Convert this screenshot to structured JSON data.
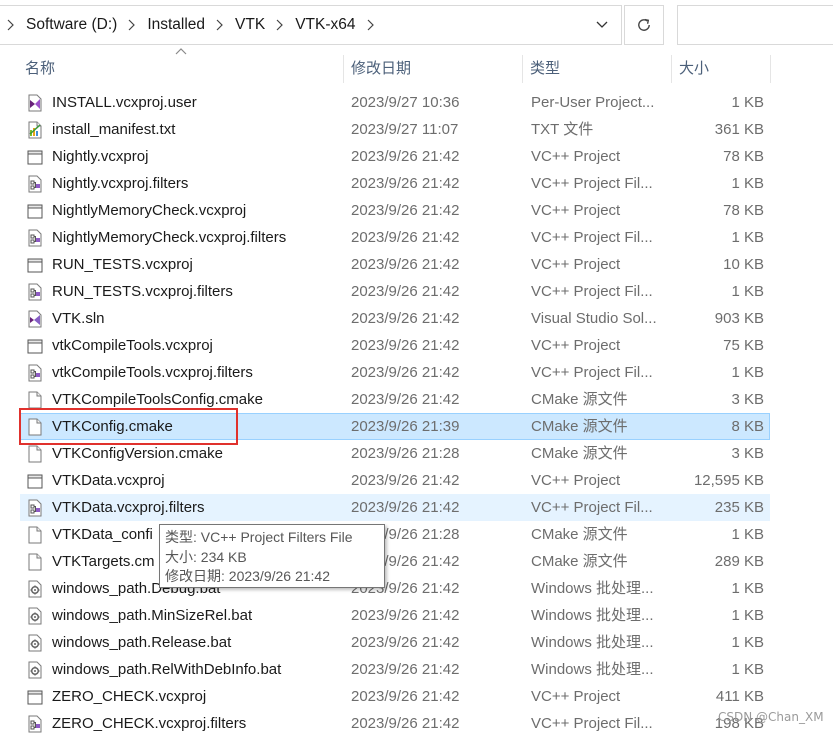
{
  "breadcrumb": [
    {
      "label": "Software (D:)"
    },
    {
      "label": "Installed"
    },
    {
      "label": "VTK"
    },
    {
      "label": "VTK-x64"
    }
  ],
  "columns": {
    "name": "名称",
    "date": "修改日期",
    "type": "类型",
    "size": "大小"
  },
  "files": [
    {
      "name": "INSTALL.vcxproj.user",
      "date": "2023/9/27 10:36",
      "type": "Per-User Project...",
      "size": "1 KB",
      "icon": "vs-user-file-icon"
    },
    {
      "name": "install_manifest.txt",
      "date": "2023/9/27 11:07",
      "type": "TXT 文件",
      "size": "361 KB",
      "icon": "text-file-icon"
    },
    {
      "name": "Nightly.vcxproj",
      "date": "2023/9/26 21:42",
      "type": "VC++ Project",
      "size": "78 KB",
      "icon": "vcxproj-file-icon"
    },
    {
      "name": "Nightly.vcxproj.filters",
      "date": "2023/9/26 21:42",
      "type": "VC++ Project Fil...",
      "size": "1 KB",
      "icon": "filters-file-icon"
    },
    {
      "name": "NightlyMemoryCheck.vcxproj",
      "date": "2023/9/26 21:42",
      "type": "VC++ Project",
      "size": "78 KB",
      "icon": "vcxproj-file-icon"
    },
    {
      "name": "NightlyMemoryCheck.vcxproj.filters",
      "date": "2023/9/26 21:42",
      "type": "VC++ Project Fil...",
      "size": "1 KB",
      "icon": "filters-file-icon"
    },
    {
      "name": "RUN_TESTS.vcxproj",
      "date": "2023/9/26 21:42",
      "type": "VC++ Project",
      "size": "10 KB",
      "icon": "vcxproj-file-icon"
    },
    {
      "name": "RUN_TESTS.vcxproj.filters",
      "date": "2023/9/26 21:42",
      "type": "VC++ Project Fil...",
      "size": "1 KB",
      "icon": "filters-file-icon"
    },
    {
      "name": "VTK.sln",
      "date": "2023/9/26 21:42",
      "type": "Visual Studio Sol...",
      "size": "903 KB",
      "icon": "sln-file-icon"
    },
    {
      "name": "vtkCompileTools.vcxproj",
      "date": "2023/9/26 21:42",
      "type": "VC++ Project",
      "size": "75 KB",
      "icon": "vcxproj-file-icon"
    },
    {
      "name": "vtkCompileTools.vcxproj.filters",
      "date": "2023/9/26 21:42",
      "type": "VC++ Project Fil...",
      "size": "1 KB",
      "icon": "filters-file-icon"
    },
    {
      "name": "VTKCompileToolsConfig.cmake",
      "date": "2023/9/26 21:42",
      "type": "CMake 源文件",
      "size": "3 KB",
      "icon": "blank-file-icon"
    },
    {
      "name": "VTKConfig.cmake",
      "date": "2023/9/26 21:39",
      "type": "CMake 源文件",
      "size": "8 KB",
      "icon": "blank-file-icon",
      "state": "selected"
    },
    {
      "name": "VTKConfigVersion.cmake",
      "date": "2023/9/26 21:28",
      "type": "CMake 源文件",
      "size": "3 KB",
      "icon": "blank-file-icon"
    },
    {
      "name": "VTKData.vcxproj",
      "date": "2023/9/26 21:42",
      "type": "VC++ Project",
      "size": "12,595 KB",
      "icon": "vcxproj-file-icon"
    },
    {
      "name": "VTKData.vcxproj.filters",
      "date": "2023/9/26 21:42",
      "type": "VC++ Project Fil...",
      "size": "235 KB",
      "icon": "filters-file-icon",
      "state": "hover"
    },
    {
      "name": "VTKData_confi",
      "date": "2023/9/26 21:28",
      "type": "CMake 源文件",
      "size": "1 KB",
      "icon": "blank-file-icon"
    },
    {
      "name": "VTKTargets.cm",
      "date": "2023/9/26 21:42",
      "type": "CMake 源文件",
      "size": "289 KB",
      "icon": "blank-file-icon"
    },
    {
      "name": "windows_path.Debug.bat",
      "date": "2023/9/26 21:42",
      "type": "Windows 批处理...",
      "size": "1 KB",
      "icon": "bat-file-icon"
    },
    {
      "name": "windows_path.MinSizeRel.bat",
      "date": "2023/9/26 21:42",
      "type": "Windows 批处理...",
      "size": "1 KB",
      "icon": "bat-file-icon"
    },
    {
      "name": "windows_path.Release.bat",
      "date": "2023/9/26 21:42",
      "type": "Windows 批处理...",
      "size": "1 KB",
      "icon": "bat-file-icon"
    },
    {
      "name": "windows_path.RelWithDebInfo.bat",
      "date": "2023/9/26 21:42",
      "type": "Windows 批处理...",
      "size": "1 KB",
      "icon": "bat-file-icon"
    },
    {
      "name": "ZERO_CHECK.vcxproj",
      "date": "2023/9/26 21:42",
      "type": "VC++ Project",
      "size": "411 KB",
      "icon": "vcxproj-file-icon"
    },
    {
      "name": "ZERO_CHECK.vcxproj.filters",
      "date": "2023/9/26 21:42",
      "type": "VC++ Project Fil...",
      "size": "198 KB",
      "icon": "filters-file-icon"
    }
  ],
  "tooltip": {
    "type_line": "类型: VC++ Project Filters File",
    "size_line": "大小: 234 KB",
    "date_line": "修改日期: 2023/9/26 21:42"
  },
  "watermark": "CSDN @Chan_XM",
  "colors": {
    "selected_bg": "#cce8ff",
    "selected_border": "#99d1ff",
    "hover_bg": "#e5f3ff",
    "annotation_red": "#e0312d",
    "header_text": "#4c607a"
  }
}
